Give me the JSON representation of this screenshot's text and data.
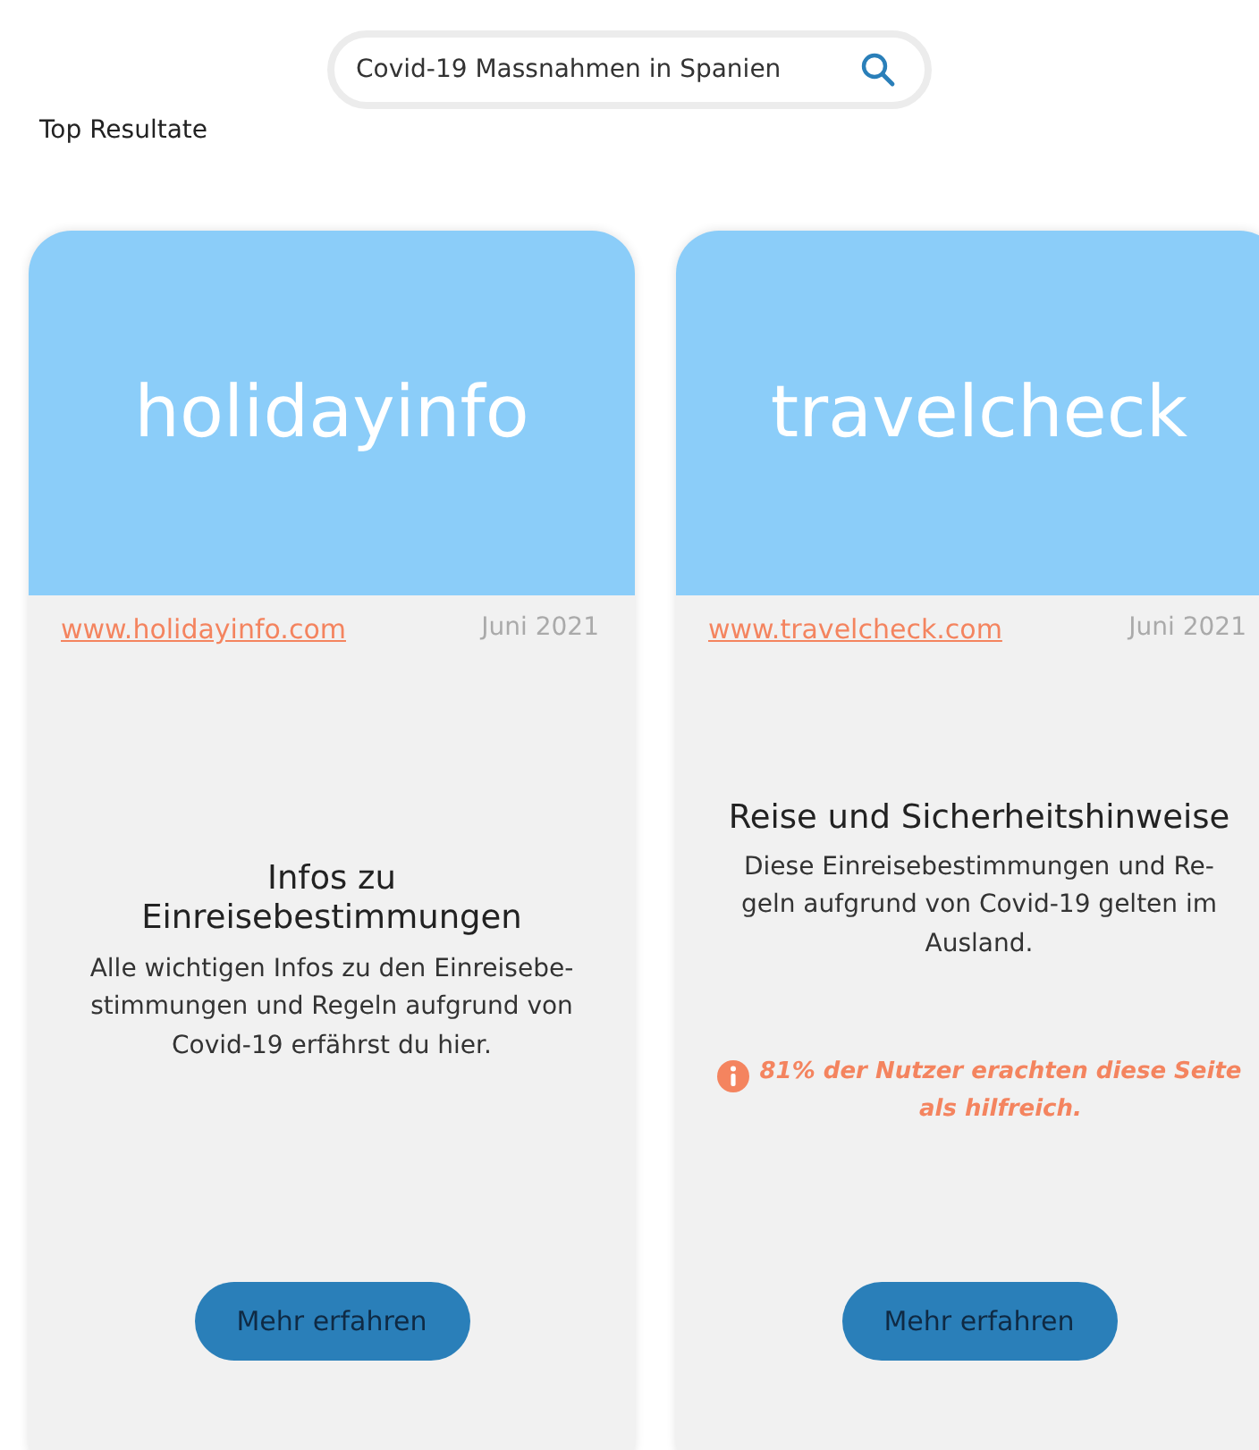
{
  "search": {
    "value": "Covid-19 Massnahmen in Spanien"
  },
  "section_title": "Top Resultate",
  "results": [
    {
      "brand": "holidayinfo",
      "url": "www.holidayinfo.com",
      "date": "Juni 2021",
      "title_lines": [
        "Infos zu",
        "Einreisebestimmungen"
      ],
      "description_lines": [
        "Alle wichtigen Infos zu den Einreisebe-",
        "stimmungen und Regeln aufgrund von",
        "Covid-19 erfährst du hier."
      ],
      "button": "Mehr erfahren"
    },
    {
      "brand": "travelcheck",
      "url": "www.travelcheck.com",
      "date": "Juni 2021",
      "title_lines": [
        "Reise und Sicherheitshinweise"
      ],
      "description_lines": [
        "Diese Einreisebestimmungen und Re-",
        "geln aufgrund von Covid-19 gelten im",
        "Ausland."
      ],
      "note_lines": [
        "81% der Nutzer erachten diese Seite",
        "als hilfreich."
      ],
      "button": "Mehr erfahren"
    }
  ]
}
